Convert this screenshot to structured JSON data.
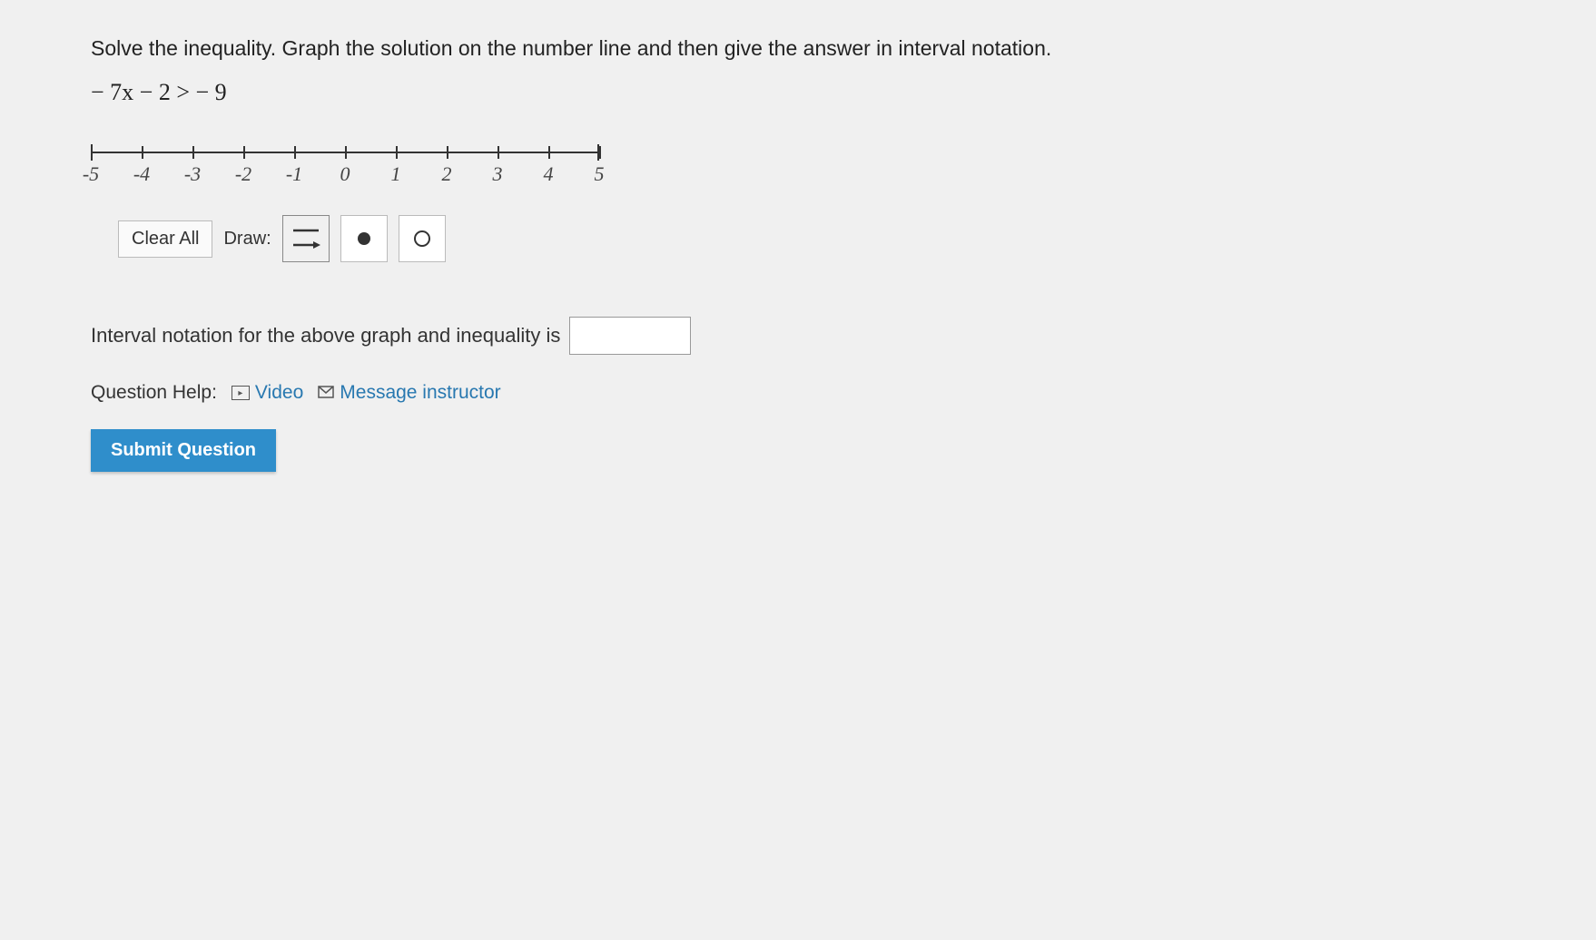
{
  "question": {
    "prompt": "Solve the inequality. Graph the solution on the number line and then give the answer in interval notation.",
    "inequality": "− 7x − 2 >  − 9"
  },
  "numberLine": {
    "ticks": [
      "-5",
      "-4",
      "-3",
      "-2",
      "-1",
      "0",
      "1",
      "2",
      "3",
      "4",
      "5"
    ]
  },
  "toolbar": {
    "clear": "Clear All",
    "drawLabel": "Draw:"
  },
  "interval": {
    "label": "Interval notation for the above graph and inequality is",
    "value": ""
  },
  "help": {
    "label": "Question Help:",
    "video": "Video",
    "message": "Message instructor"
  },
  "submit": "Submit Question"
}
